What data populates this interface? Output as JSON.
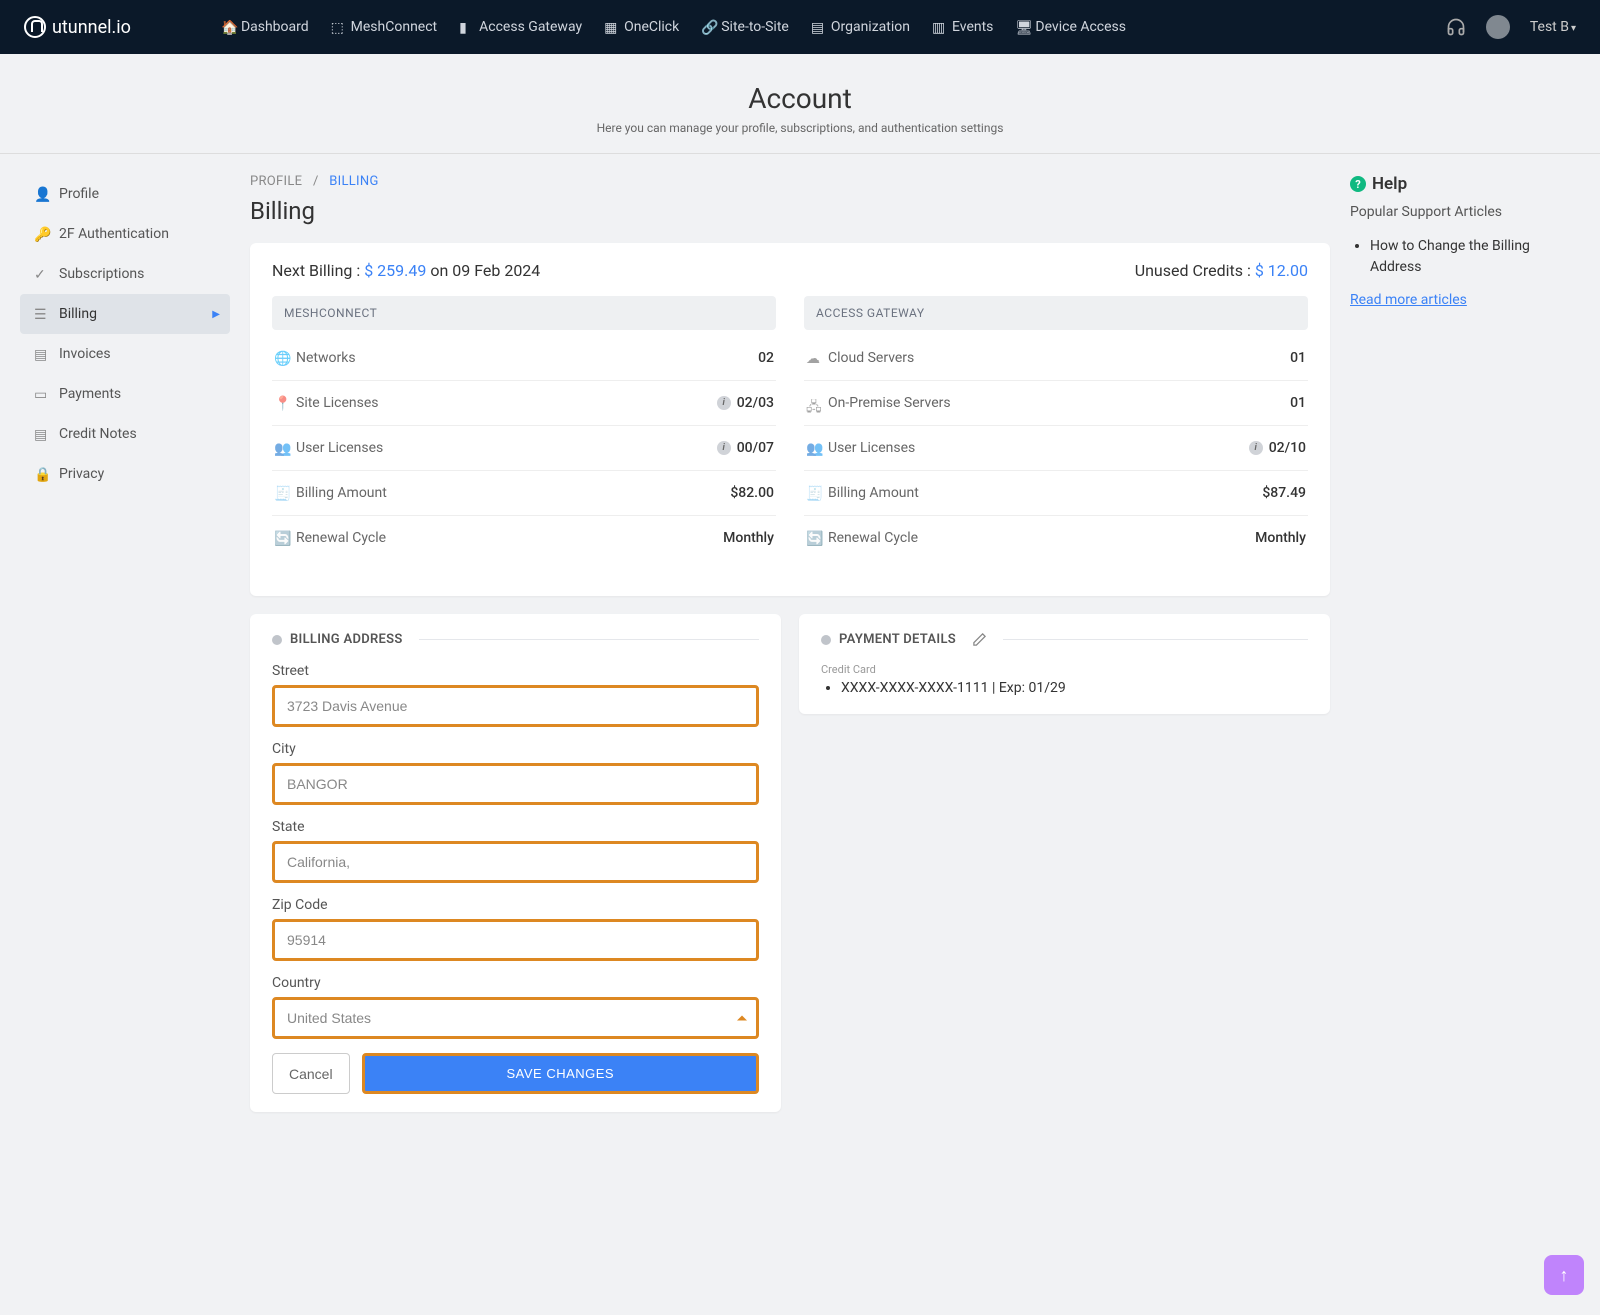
{
  "brand": "utunnel.io",
  "nav": {
    "dashboard": "Dashboard",
    "meshconnect": "MeshConnect",
    "access_gateway": "Access Gateway",
    "oneclick": "OneClick",
    "site_to_site": "Site-to-Site",
    "organization": "Organization",
    "events": "Events",
    "device_access": "Device Access"
  },
  "user": {
    "name": "Test B"
  },
  "page": {
    "title": "Account",
    "subtitle": "Here you can manage your profile, subscriptions, and authentication settings"
  },
  "sidebar": {
    "profile": "Profile",
    "twofa": "2F Authentication",
    "subscriptions": "Subscriptions",
    "billing": "Billing",
    "invoices": "Invoices",
    "payments": "Payments",
    "credit_notes": "Credit Notes",
    "privacy": "Privacy"
  },
  "breadcrumb": {
    "root": "PROFILE",
    "sep": "/",
    "current": "BILLING"
  },
  "section_title": "Billing",
  "summary": {
    "next_label": "Next Billing :",
    "next_amount": "$ 259.49",
    "next_date_prefix": "on",
    "next_date": "09 Feb 2024",
    "credits_label": "Unused Credits :",
    "credits_amount": "$ 12.00"
  },
  "mesh": {
    "header": "MESHCONNECT",
    "networks_label": "Networks",
    "networks_value": "02",
    "site_label": "Site Licenses",
    "site_value": "02/03",
    "user_label": "User Licenses",
    "user_value": "00/07",
    "amount_label": "Billing Amount",
    "amount_value": "$82.00",
    "cycle_label": "Renewal Cycle",
    "cycle_value": "Monthly"
  },
  "gateway": {
    "header": "ACCESS GATEWAY",
    "cloud_label": "Cloud Servers",
    "cloud_value": "01",
    "onprem_label": "On-Premise Servers",
    "onprem_value": "01",
    "user_label": "User Licenses",
    "user_value": "02/10",
    "amount_label": "Billing Amount",
    "amount_value": "$87.49",
    "cycle_label": "Renewal Cycle",
    "cycle_value": "Monthly"
  },
  "address": {
    "panel": "BILLING ADDRESS",
    "street_label": "Street",
    "street_value": "3723 Davis Avenue",
    "city_label": "City",
    "city_value": "BANGOR",
    "state_label": "State",
    "state_value": "California,",
    "zip_label": "Zip Code",
    "zip_value": "95914",
    "country_label": "Country",
    "country_value": "United States",
    "cancel": "Cancel",
    "save": "SAVE CHANGES"
  },
  "payment": {
    "panel": "PAYMENT DETAILS",
    "cc_label": "Credit Card",
    "cc_value": "XXXX-XXXX-XXXX-1111 | Exp: 01/29"
  },
  "help": {
    "title": "Help",
    "subtitle": "Popular Support Articles",
    "article1": "How to Change the Billing Address",
    "more": "Read more articles"
  }
}
